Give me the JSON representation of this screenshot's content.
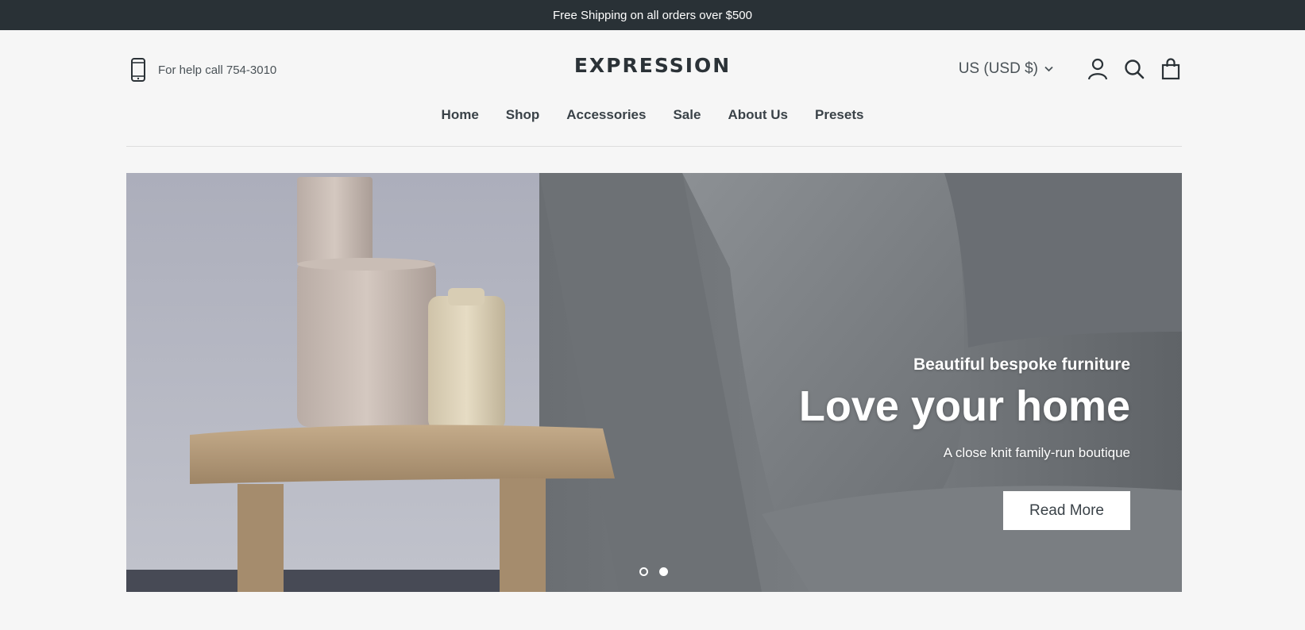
{
  "announcement": {
    "text": "Free Shipping on all orders over $500"
  },
  "header": {
    "help": {
      "icon": "phone-icon",
      "text": "For help call 754-3010"
    },
    "logo": "EXPRESSION",
    "currency": {
      "label": "US (USD $)",
      "icon": "chevron-down-icon"
    },
    "icons": [
      "account-icon",
      "search-icon",
      "cart-icon"
    ]
  },
  "nav": {
    "items": [
      {
        "label": "Home"
      },
      {
        "label": "Shop"
      },
      {
        "label": "Accessories"
      },
      {
        "label": "Sale"
      },
      {
        "label": "About Us"
      },
      {
        "label": "Presets"
      }
    ]
  },
  "hero": {
    "kicker": "Beautiful bespoke furniture",
    "title": "Love your home",
    "subtitle": "A close knit family-run boutique",
    "button_label": "Read More",
    "slides_count": 2,
    "active_slide": 2
  },
  "colors": {
    "announcement_bg": "#293136",
    "page_bg": "#f6f6f6",
    "text_dark": "#2b3237",
    "button_bg": "#ffffff"
  }
}
